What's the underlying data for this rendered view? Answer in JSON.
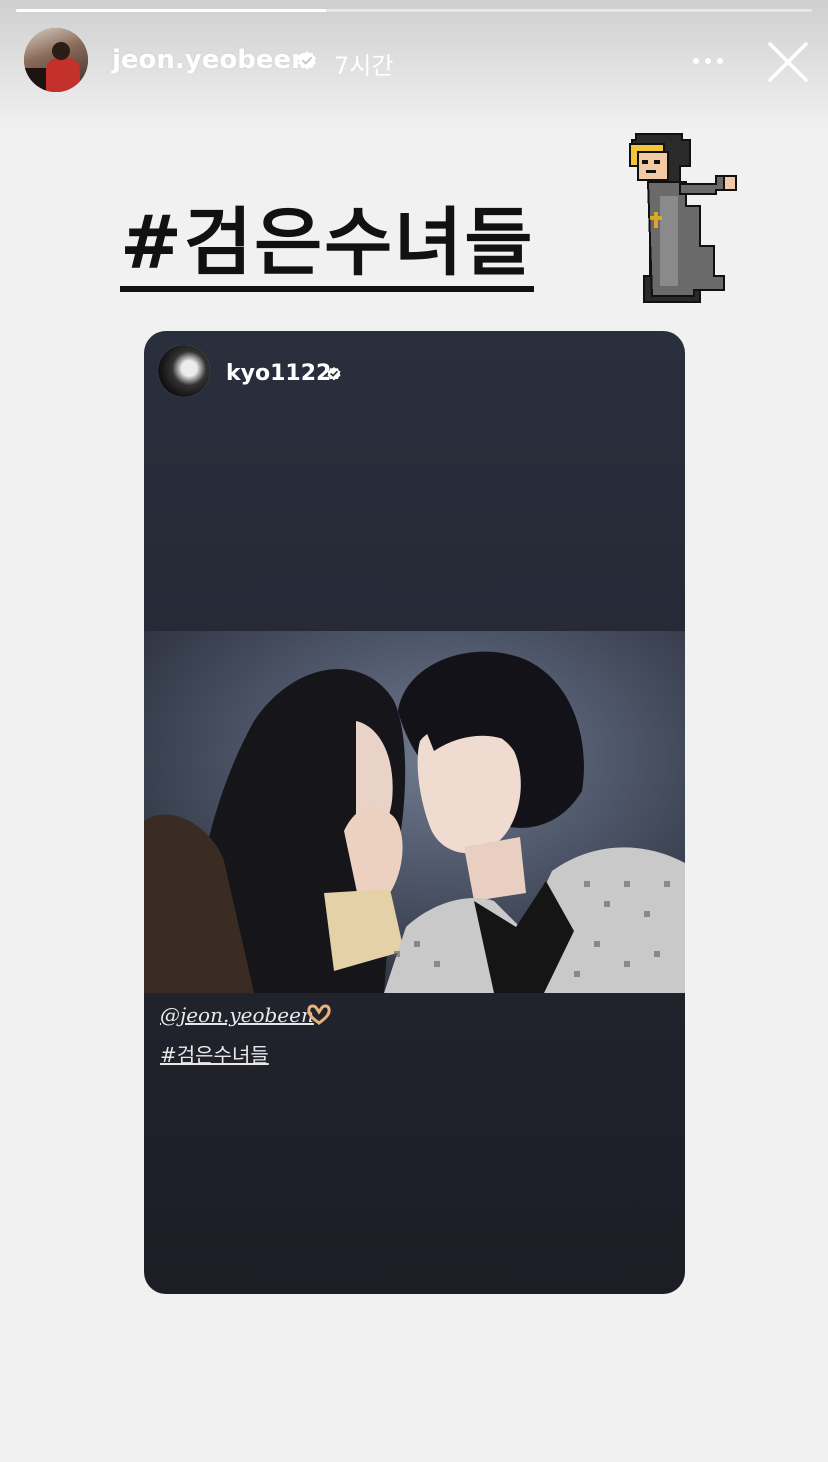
{
  "story": {
    "progress": 0.39
  },
  "header": {
    "username": "jeon.yeobeen",
    "time": "7시간",
    "avatar_icon": "profile-photo",
    "verified_icon": "verified-badge-icon",
    "more_icon": "more-dots-icon",
    "close_icon": "close-icon"
  },
  "sticker": {
    "hashtag": "#검은수녀들",
    "gif": "pixel-nun-sticker"
  },
  "shared_post": {
    "username": "kyo1122",
    "caption_mention": "@jeon.yeobeen",
    "caption_emoji_icon": "heart-hands-icon",
    "caption_hashtag": "#검은수녀들"
  },
  "colors": {
    "background": "#f1f1f1",
    "card": "#262a37",
    "text_light": "#ffffff"
  }
}
